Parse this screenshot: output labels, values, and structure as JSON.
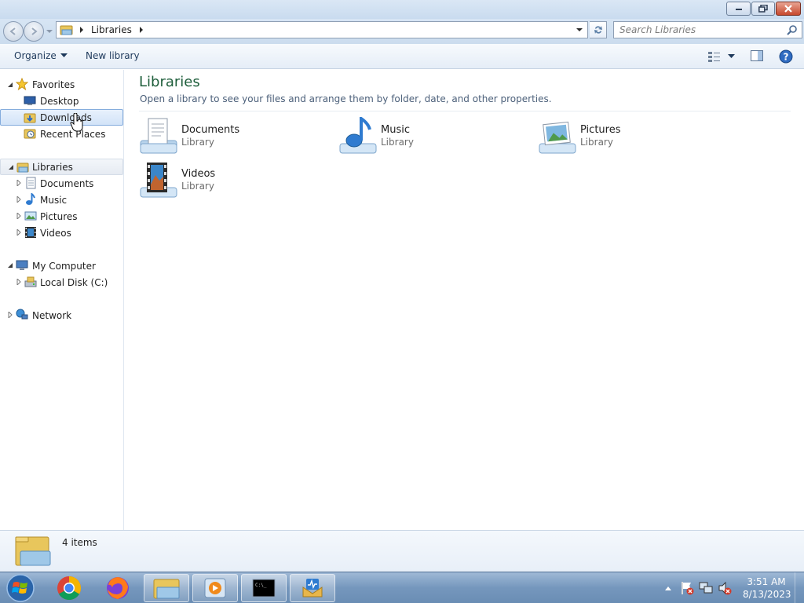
{
  "window": {
    "title_buttons": {
      "minimize": "minimize-icon",
      "maximize": "restore-icon",
      "close": "close-icon"
    }
  },
  "address_bar": {
    "path": [
      "Libraries"
    ],
    "search_placeholder": "Search Libraries"
  },
  "toolbar": {
    "organize_label": "Organize",
    "new_library_label": "New library"
  },
  "nav": {
    "favorites": {
      "label": "Favorites",
      "items": [
        "Desktop",
        "Downloads",
        "Recent Places"
      ]
    },
    "libraries": {
      "label": "Libraries",
      "items": [
        "Documents",
        "Music",
        "Pictures",
        "Videos"
      ]
    },
    "computer": {
      "label": "My Computer",
      "items": [
        "Local Disk (C:)"
      ]
    },
    "network": {
      "label": "Network"
    },
    "selected": "Downloads"
  },
  "main": {
    "title": "Libraries",
    "subtitle": "Open a library to see your files and arrange them by folder, date, and other properties.",
    "libraries": [
      {
        "name": "Documents",
        "type": "Library",
        "icon": "documents-library-icon"
      },
      {
        "name": "Music",
        "type": "Library",
        "icon": "music-library-icon"
      },
      {
        "name": "Pictures",
        "type": "Library",
        "icon": "pictures-library-icon"
      },
      {
        "name": "Videos",
        "type": "Library",
        "icon": "videos-library-icon"
      }
    ]
  },
  "details": {
    "count": "4 items"
  },
  "taskbar": {
    "apps": [
      "chrome-icon",
      "firefox-icon",
      "file-explorer-icon",
      "media-player-icon",
      "command-prompt-icon",
      "app-icon"
    ],
    "clock": {
      "time": "3:51 AM",
      "date": "8/13/2023"
    }
  },
  "colors": {
    "title_green": "#1e5e3b",
    "selection_blue": "#d2e3f8",
    "taskbar": "#7597bd"
  }
}
